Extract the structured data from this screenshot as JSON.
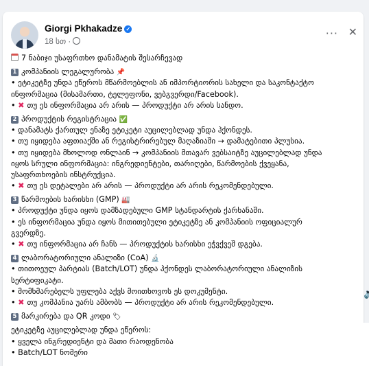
{
  "post": {
    "author": "Giorgi Pkhakadze",
    "time": "18 სთ ·",
    "more_icon": "more-options-icon",
    "close_icon": "close-icon",
    "lines": [
      {
        "type": "title",
        "icon": "calendar",
        "text": "7 ნაბიჯი უსაფრთხო დანამატის შესარჩევად"
      },
      {
        "type": "gap"
      },
      {
        "type": "head",
        "num": "1",
        "text": "კომპანიის ლეგალურობა",
        "emoji": "📌"
      },
      {
        "type": "text",
        "text": "• ეტიკეტზე უნდა ეწეროს მწარმოებლის ან იმპორტიორის სახელი და საკონტაქტო"
      },
      {
        "type": "text",
        "text": "ინფორმაცია (მისამართი, ტელეფონი, ვებგვერდი/Facebook)."
      },
      {
        "type": "warn",
        "text": "თუ ეს ინფორმაცია არ არის — პროდუქტი არ არის სანდო."
      },
      {
        "type": "gap"
      },
      {
        "type": "head",
        "num": "2",
        "text": "პროდუქტის რეგისტრაცია",
        "emoji": "✅"
      },
      {
        "type": "text",
        "text": "• დანამატს ქართულ ენაზე ეტიკეტი აუცილებლად უნდა ჰქონდეს."
      },
      {
        "type": "text",
        "text": "• თუ იყიდება აფთიაქში ან რეგისტრირებულ მაღაზიაში → დამატებითი პლუსია."
      },
      {
        "type": "text",
        "text": "• თუ იყიდება მხოლოდ ონლაინ → კომპანიის მთავარ ვებსაიტზე აუცილებლად უნდა"
      },
      {
        "type": "text",
        "text": "იყოს სრული ინფორმაცია: ინგრედიენტები, თარიღები, წარმოების ქვეყანა,"
      },
      {
        "type": "text",
        "text": "უსაფრთხოების ინსტრუქცია."
      },
      {
        "type": "warn",
        "text": "თუ ეს დეტალები არ არის — პროდუქტი არ არის რეკომენდებული."
      },
      {
        "type": "gap"
      },
      {
        "type": "head",
        "num": "3",
        "text": "წარმოების ხარისხი (GMP)",
        "emoji": "🏭"
      },
      {
        "type": "text",
        "text": "• პროდუქტი უნდა იყოს დამზადებული GMP სტანდარტის ქარხანაში."
      },
      {
        "type": "text",
        "text": "• ეს ინფორმაცია უნდა იყოს მითითებული ეტიკეტზე ან კომპანიის ოფიციალურ"
      },
      {
        "type": "text",
        "text": "გვერდზე."
      },
      {
        "type": "warn",
        "text": "თუ ინფორმაცია არ ჩანს — პროდუქტის ხარისხი ეჭვქვეშ დგება."
      },
      {
        "type": "gap"
      },
      {
        "type": "head",
        "num": "4",
        "text": "ლაბორატორიული ანალიზი (CoA)",
        "emoji": "🔬"
      },
      {
        "type": "text",
        "text": "• თითოეულ პარტიას (Batch/LOT) უნდა ჰქონდეს ლაბორატორიული ანალიზის"
      },
      {
        "type": "text",
        "text": "სერტიფიკატი."
      },
      {
        "type": "text",
        "text": "• მომხმარებელს უფლება აქვს მოითხოვოს ეს დოკუმენტი."
      },
      {
        "type": "warn",
        "text": "თუ კომპანია უარს ამბობს — პროდუქტი არ არის რეკომენდებული."
      },
      {
        "type": "gap"
      },
      {
        "type": "head",
        "num": "5",
        "text": "მარკირება და QR კოდი",
        "emoji": "🏷"
      },
      {
        "type": "gap"
      },
      {
        "type": "text",
        "text": "ეტიკეტზე აუცილებლად უნდა ეწეროს:"
      },
      {
        "type": "text",
        "text": "• ყველა ინგრედიენტი და მათი რაოდენობა"
      },
      {
        "type": "text",
        "text": "• Batch/LOT ნომერი"
      }
    ]
  },
  "side_icon": "speaker-icon",
  "colors": {
    "link": "#1877f2",
    "warn": "#e0245e",
    "muted": "#65676b"
  }
}
